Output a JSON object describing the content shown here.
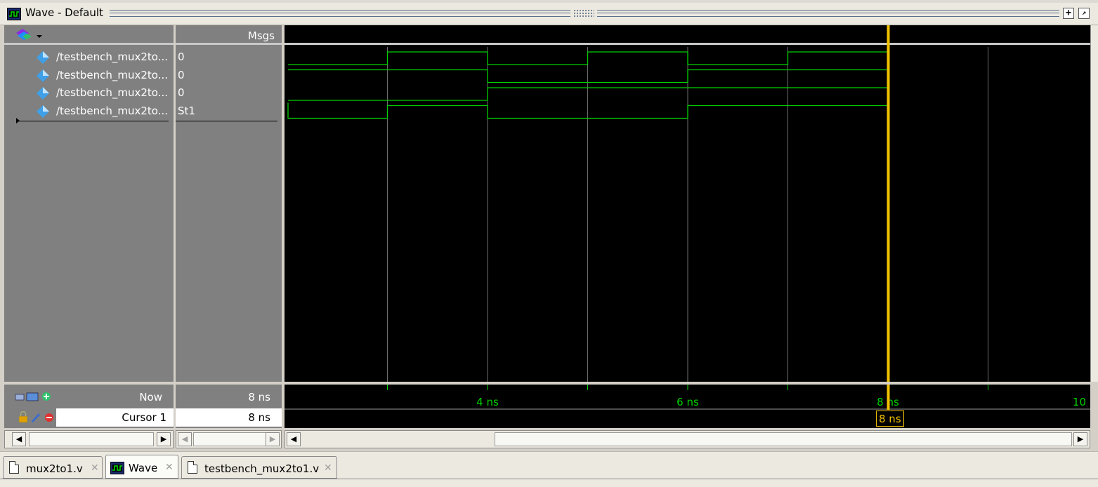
{
  "window": {
    "title": "Wave - Default"
  },
  "header": {
    "msgs_label": "Msgs"
  },
  "signals": [
    {
      "name": "/testbench_mux2to...",
      "value": "0"
    },
    {
      "name": "/testbench_mux2to...",
      "value": "0"
    },
    {
      "name": "/testbench_mux2to...",
      "value": "0"
    },
    {
      "name": "/testbench_mux2to...",
      "value": "St1"
    }
  ],
  "status": {
    "now_label": "Now",
    "now_value": "8 ns",
    "cursor_label": "Cursor 1",
    "cursor_value": "8 ns"
  },
  "timeline": {
    "tick_labels": [
      "4 ns",
      "6 ns",
      "8 ns",
      "10"
    ],
    "cursor_label": "8 ns",
    "cursor_time_ns": 8
  },
  "waveforms": [
    {
      "transitions": [
        [
          0,
          0
        ],
        [
          3,
          1
        ],
        [
          4,
          0
        ],
        [
          5,
          1
        ],
        [
          6,
          0
        ],
        [
          7,
          1
        ]
      ]
    },
    {
      "transitions": [
        [
          0,
          1
        ],
        [
          4,
          0
        ],
        [
          6,
          1
        ]
      ]
    },
    {
      "transitions": [
        [
          0,
          0
        ],
        [
          4,
          1
        ]
      ]
    },
    {
      "transitions": [
        [
          0,
          0
        ],
        [
          3,
          1
        ],
        [
          4,
          0
        ],
        [
          6,
          1
        ]
      ]
    }
  ],
  "tabs": [
    {
      "label": "mux2to1.v",
      "active": false
    },
    {
      "label": "Wave",
      "active": true
    },
    {
      "label": "testbench_mux2to1.v",
      "active": false
    }
  ],
  "colors": {
    "wave": "#00d000",
    "cursor": "#f0c000",
    "grid": "#6e6e6e",
    "signal_icon": "#3fa0e8"
  }
}
